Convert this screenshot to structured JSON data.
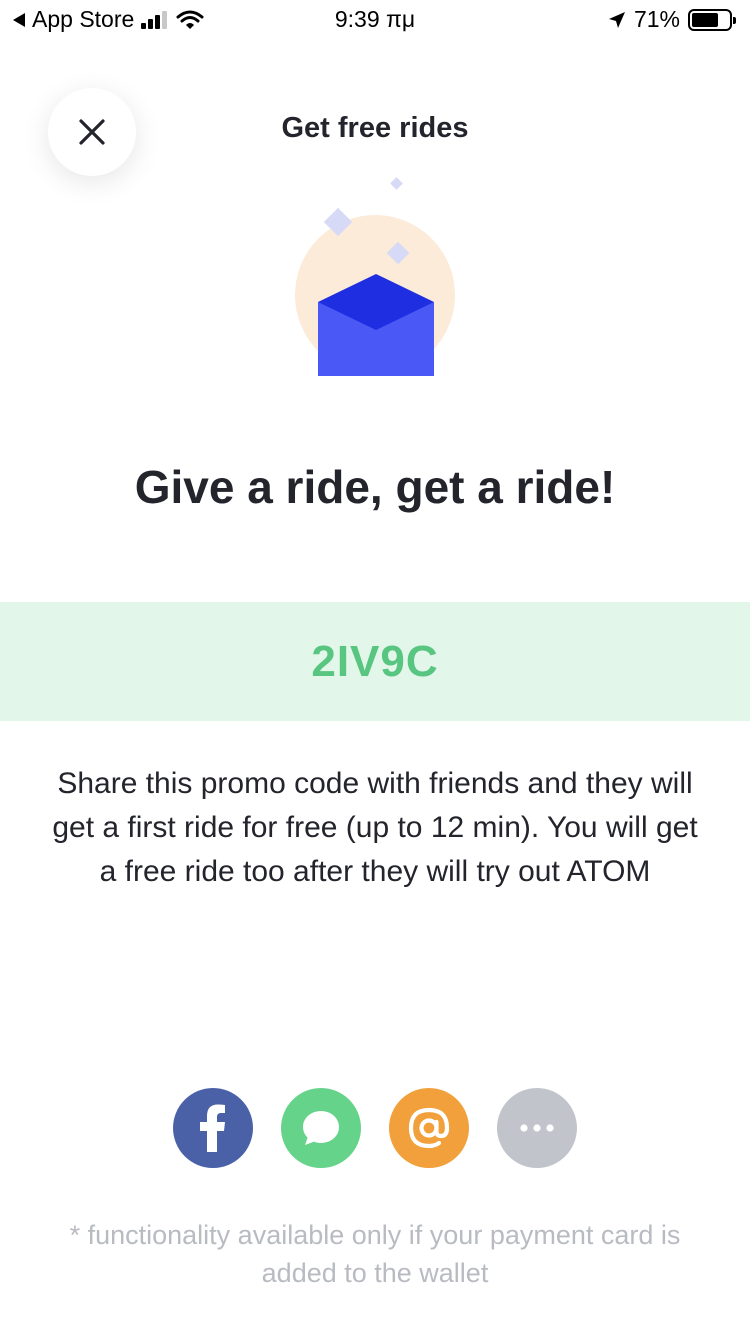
{
  "status_bar": {
    "back_app": "App Store",
    "time": "9:39 πμ",
    "battery_percent": "71%",
    "battery_level": 0.71
  },
  "header": {
    "title": "Get free rides",
    "close_icon": "close-icon"
  },
  "illustration": {
    "icon": "envelope-icon",
    "colors": {
      "circle": "#fcebd8",
      "envelope_dark": "#1f2ee0",
      "envelope_light": "#4a58f5",
      "sparkle": "#d7daf7"
    }
  },
  "headline": "Give a ride, get a ride!",
  "promo": {
    "code": "2IV9C",
    "background": "#e2f6ea",
    "color": "#58c580"
  },
  "description": "Share this promo code with friends and they will get a first ride for free (up to 12 min). You will get a free ride too after they will try out ATOM",
  "share": [
    {
      "icon": "facebook-icon",
      "color": "#4a61a8"
    },
    {
      "icon": "message-icon",
      "color": "#66d38a"
    },
    {
      "icon": "at-sign-icon",
      "color": "#f1a03b"
    },
    {
      "icon": "more-icon",
      "color": "#c1c4cb"
    }
  ],
  "footnote": "* functionality available only if your payment card is added to the wallet"
}
